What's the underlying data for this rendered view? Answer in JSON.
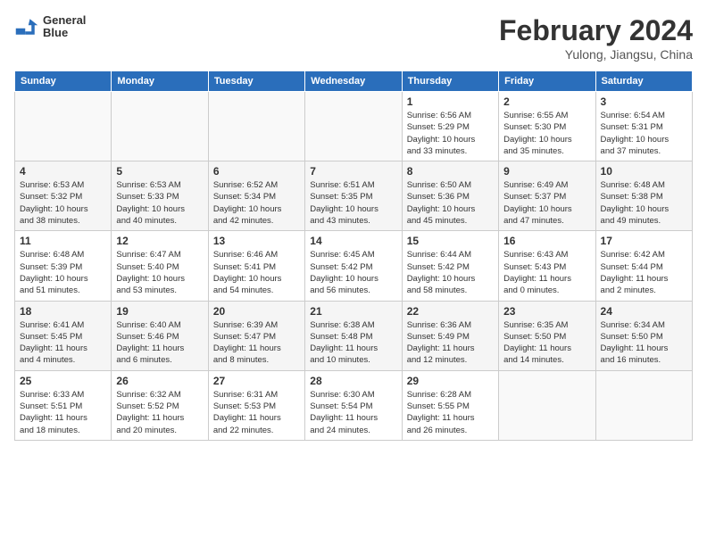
{
  "header": {
    "logo_line1": "General",
    "logo_line2": "Blue",
    "month": "February 2024",
    "location": "Yulong, Jiangsu, China"
  },
  "weekdays": [
    "Sunday",
    "Monday",
    "Tuesday",
    "Wednesday",
    "Thursday",
    "Friday",
    "Saturday"
  ],
  "weeks": [
    [
      {
        "day": "",
        "info": ""
      },
      {
        "day": "",
        "info": ""
      },
      {
        "day": "",
        "info": ""
      },
      {
        "day": "",
        "info": ""
      },
      {
        "day": "1",
        "info": "Sunrise: 6:56 AM\nSunset: 5:29 PM\nDaylight: 10 hours\nand 33 minutes."
      },
      {
        "day": "2",
        "info": "Sunrise: 6:55 AM\nSunset: 5:30 PM\nDaylight: 10 hours\nand 35 minutes."
      },
      {
        "day": "3",
        "info": "Sunrise: 6:54 AM\nSunset: 5:31 PM\nDaylight: 10 hours\nand 37 minutes."
      }
    ],
    [
      {
        "day": "4",
        "info": "Sunrise: 6:53 AM\nSunset: 5:32 PM\nDaylight: 10 hours\nand 38 minutes."
      },
      {
        "day": "5",
        "info": "Sunrise: 6:53 AM\nSunset: 5:33 PM\nDaylight: 10 hours\nand 40 minutes."
      },
      {
        "day": "6",
        "info": "Sunrise: 6:52 AM\nSunset: 5:34 PM\nDaylight: 10 hours\nand 42 minutes."
      },
      {
        "day": "7",
        "info": "Sunrise: 6:51 AM\nSunset: 5:35 PM\nDaylight: 10 hours\nand 43 minutes."
      },
      {
        "day": "8",
        "info": "Sunrise: 6:50 AM\nSunset: 5:36 PM\nDaylight: 10 hours\nand 45 minutes."
      },
      {
        "day": "9",
        "info": "Sunrise: 6:49 AM\nSunset: 5:37 PM\nDaylight: 10 hours\nand 47 minutes."
      },
      {
        "day": "10",
        "info": "Sunrise: 6:48 AM\nSunset: 5:38 PM\nDaylight: 10 hours\nand 49 minutes."
      }
    ],
    [
      {
        "day": "11",
        "info": "Sunrise: 6:48 AM\nSunset: 5:39 PM\nDaylight: 10 hours\nand 51 minutes."
      },
      {
        "day": "12",
        "info": "Sunrise: 6:47 AM\nSunset: 5:40 PM\nDaylight: 10 hours\nand 53 minutes."
      },
      {
        "day": "13",
        "info": "Sunrise: 6:46 AM\nSunset: 5:41 PM\nDaylight: 10 hours\nand 54 minutes."
      },
      {
        "day": "14",
        "info": "Sunrise: 6:45 AM\nSunset: 5:42 PM\nDaylight: 10 hours\nand 56 minutes."
      },
      {
        "day": "15",
        "info": "Sunrise: 6:44 AM\nSunset: 5:42 PM\nDaylight: 10 hours\nand 58 minutes."
      },
      {
        "day": "16",
        "info": "Sunrise: 6:43 AM\nSunset: 5:43 PM\nDaylight: 11 hours\nand 0 minutes."
      },
      {
        "day": "17",
        "info": "Sunrise: 6:42 AM\nSunset: 5:44 PM\nDaylight: 11 hours\nand 2 minutes."
      }
    ],
    [
      {
        "day": "18",
        "info": "Sunrise: 6:41 AM\nSunset: 5:45 PM\nDaylight: 11 hours\nand 4 minutes."
      },
      {
        "day": "19",
        "info": "Sunrise: 6:40 AM\nSunset: 5:46 PM\nDaylight: 11 hours\nand 6 minutes."
      },
      {
        "day": "20",
        "info": "Sunrise: 6:39 AM\nSunset: 5:47 PM\nDaylight: 11 hours\nand 8 minutes."
      },
      {
        "day": "21",
        "info": "Sunrise: 6:38 AM\nSunset: 5:48 PM\nDaylight: 11 hours\nand 10 minutes."
      },
      {
        "day": "22",
        "info": "Sunrise: 6:36 AM\nSunset: 5:49 PM\nDaylight: 11 hours\nand 12 minutes."
      },
      {
        "day": "23",
        "info": "Sunrise: 6:35 AM\nSunset: 5:50 PM\nDaylight: 11 hours\nand 14 minutes."
      },
      {
        "day": "24",
        "info": "Sunrise: 6:34 AM\nSunset: 5:50 PM\nDaylight: 11 hours\nand 16 minutes."
      }
    ],
    [
      {
        "day": "25",
        "info": "Sunrise: 6:33 AM\nSunset: 5:51 PM\nDaylight: 11 hours\nand 18 minutes."
      },
      {
        "day": "26",
        "info": "Sunrise: 6:32 AM\nSunset: 5:52 PM\nDaylight: 11 hours\nand 20 minutes."
      },
      {
        "day": "27",
        "info": "Sunrise: 6:31 AM\nSunset: 5:53 PM\nDaylight: 11 hours\nand 22 minutes."
      },
      {
        "day": "28",
        "info": "Sunrise: 6:30 AM\nSunset: 5:54 PM\nDaylight: 11 hours\nand 24 minutes."
      },
      {
        "day": "29",
        "info": "Sunrise: 6:28 AM\nSunset: 5:55 PM\nDaylight: 11 hours\nand 26 minutes."
      },
      {
        "day": "",
        "info": ""
      },
      {
        "day": "",
        "info": ""
      }
    ]
  ]
}
